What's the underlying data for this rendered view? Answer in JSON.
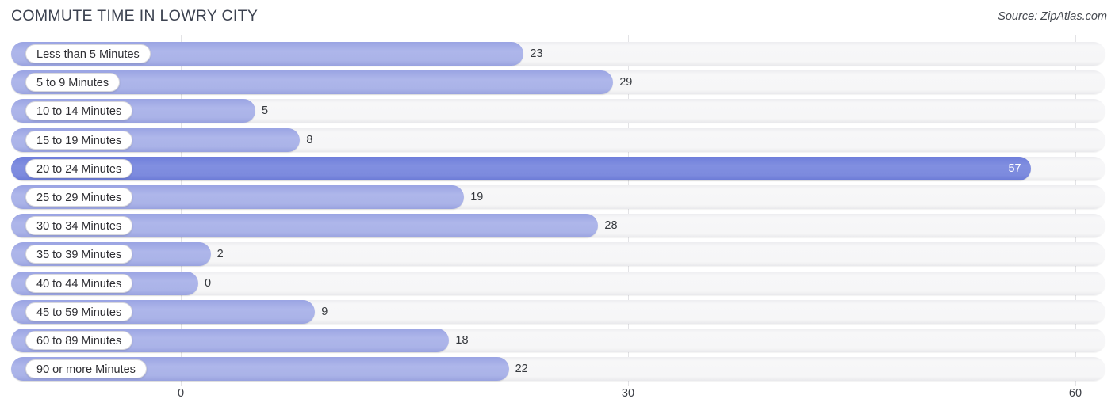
{
  "header": {
    "title": "COMMUTE TIME IN LOWRY CITY",
    "source": "Source: ZipAtlas.com"
  },
  "chart_data": {
    "type": "bar",
    "orientation": "horizontal",
    "title": "COMMUTE TIME IN LOWRY CITY",
    "subtitle": "",
    "xlabel": "",
    "ylabel": "",
    "xlim": [
      0,
      60
    ],
    "grid": true,
    "legend": null,
    "xticks": [
      "0",
      "30",
      "60"
    ],
    "xtick_values": [
      0,
      30,
      60
    ],
    "categories": [
      "Less than 5 Minutes",
      "5 to 9 Minutes",
      "10 to 14 Minutes",
      "15 to 19 Minutes",
      "20 to 24 Minutes",
      "25 to 29 Minutes",
      "30 to 34 Minutes",
      "35 to 39 Minutes",
      "40 to 44 Minutes",
      "45 to 59 Minutes",
      "60 to 89 Minutes",
      "90 or more Minutes"
    ],
    "values": [
      23,
      29,
      5,
      8,
      57,
      19,
      28,
      2,
      0,
      9,
      18,
      22
    ],
    "value_labels": [
      "23",
      "29",
      "5",
      "8",
      "57",
      "19",
      "28",
      "2",
      "0",
      "9",
      "18",
      "22"
    ],
    "highlight_index": 4,
    "colors": {
      "bar": "#aab3e8",
      "bar_highlight": "#7b8ade",
      "track": "#f6f6f7",
      "gridline": "#e3e3e6",
      "text": "#35383d",
      "title": "#3c4250"
    }
  }
}
